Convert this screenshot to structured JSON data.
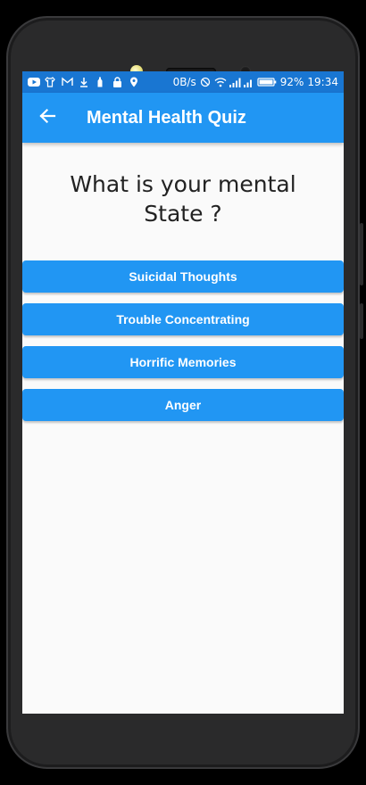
{
  "status_bar": {
    "network_speed": "0B/s",
    "battery_percent": "92%",
    "time": "19:34",
    "left_icons": [
      "youtube-icon",
      "shirt-icon",
      "gmail-icon",
      "download-icon",
      "bottle-icon",
      "lock-icon",
      "location-icon"
    ],
    "right_icons": [
      "mute-icon",
      "wifi-icon",
      "signal-icon",
      "signal-icon-2",
      "battery-icon"
    ]
  },
  "app_bar": {
    "title": "Mental Health Quiz",
    "back_icon": "arrow-back-icon"
  },
  "quiz": {
    "question": "What is your mental State ?",
    "answers": [
      "Suicidal Thoughts",
      "Trouble Concentrating",
      "Horrific Memories",
      "Anger"
    ]
  },
  "colors": {
    "status_bar": "#1976d2",
    "app_bar": "#2196f3",
    "button": "#2196f3",
    "background": "#fafafa",
    "device_frame": "#2a2a2b"
  }
}
